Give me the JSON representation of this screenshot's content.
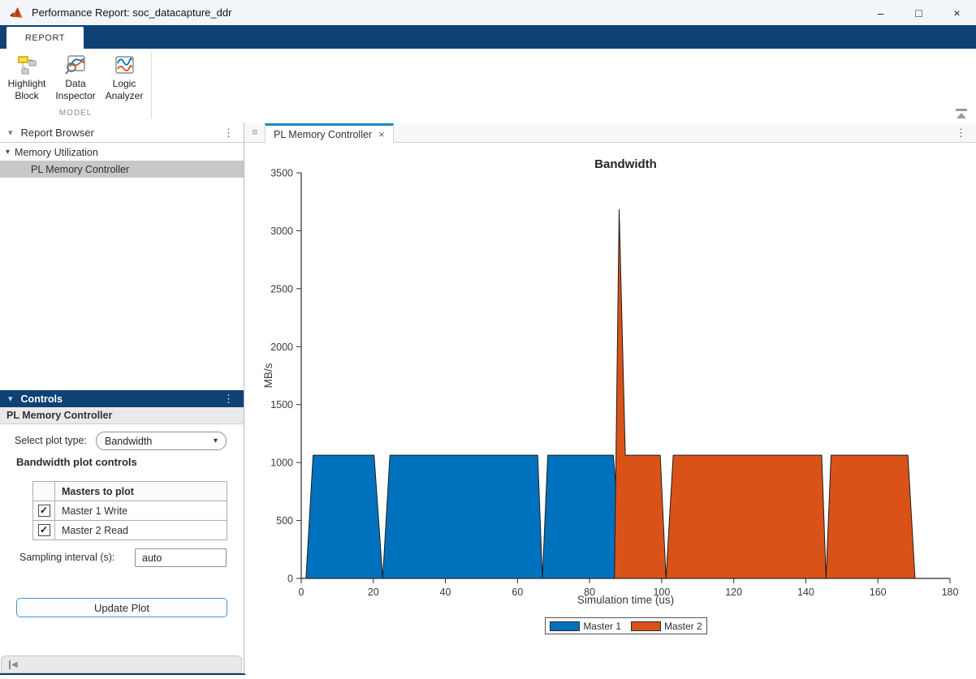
{
  "window": {
    "title": "Performance Report: soc_datacapture_ddr"
  },
  "icons": {
    "minimize": "–",
    "maximize": "□",
    "close": "×",
    "dots_menu": "⋮",
    "tree_expanded": "▾",
    "grip": "≡",
    "check": "✓",
    "dropdown_caret": "▾",
    "tab_close": "×",
    "collapse_left": "◀"
  },
  "ribbon": {
    "tab_label": "REPORT",
    "group_label": "MODEL",
    "buttons": [
      {
        "line1": "Highlight",
        "line2": "Block"
      },
      {
        "line1": "Data",
        "line2": "Inspector"
      },
      {
        "line1": "Logic",
        "line2": "Analyzer"
      }
    ]
  },
  "report_browser": {
    "title": "Report Browser",
    "tree": [
      {
        "label": "Memory Utilization",
        "expanded": true,
        "selected": false
      },
      {
        "label": "PL Memory Controller",
        "expanded": false,
        "selected": true
      }
    ]
  },
  "controls_panel": {
    "title": "Controls",
    "subtitle": "PL Memory Controller",
    "plot_type_label": "Select plot type:",
    "plot_type_value": "Bandwidth",
    "section_title": "Bandwidth plot controls",
    "masters_table": {
      "header": "Masters to plot",
      "rows": [
        {
          "checked": true,
          "label": "Master 1 Write"
        },
        {
          "checked": true,
          "label": "Master 2 Read"
        }
      ]
    },
    "sampling_label": "Sampling interval (s):",
    "sampling_value": "auto",
    "update_button_label": "Update Plot"
  },
  "main": {
    "doc_tab_label": "PL Memory Controller"
  },
  "chart_data": {
    "type": "area",
    "title": "Bandwidth",
    "xlabel": "Simulation time (us)",
    "ylabel": "MB/s",
    "xlim": [
      0,
      180
    ],
    "ylim": [
      0,
      3500
    ],
    "xticks": [
      0,
      20,
      40,
      60,
      80,
      100,
      120,
      140,
      160,
      180
    ],
    "yticks": [
      0,
      500,
      1000,
      1500,
      2000,
      2500,
      3000,
      3500
    ],
    "grid": false,
    "legend_position": "below-center",
    "series": [
      {
        "name": "Master 1",
        "color": "#0072BD",
        "points": [
          [
            1.3,
            0
          ],
          [
            3.3,
            1063
          ],
          [
            20.2,
            1063
          ],
          [
            22.6,
            0
          ],
          [
            24.6,
            1063
          ],
          [
            65.6,
            1063
          ],
          [
            66.9,
            0
          ],
          [
            68.4,
            1063
          ],
          [
            86.6,
            1063
          ],
          [
            89.3,
            0
          ]
        ]
      },
      {
        "name": "Master 2",
        "color": "#D95319",
        "points": [
          [
            86.9,
            0
          ],
          [
            88.2,
            3183
          ],
          [
            89.9,
            1063
          ],
          [
            99.6,
            1063
          ],
          [
            101.2,
            0
          ],
          [
            103.2,
            1063
          ],
          [
            144.4,
            1063
          ],
          [
            145.6,
            0
          ],
          [
            147.0,
            1063
          ],
          [
            168.3,
            1063
          ],
          [
            170.3,
            0
          ]
        ]
      }
    ]
  }
}
